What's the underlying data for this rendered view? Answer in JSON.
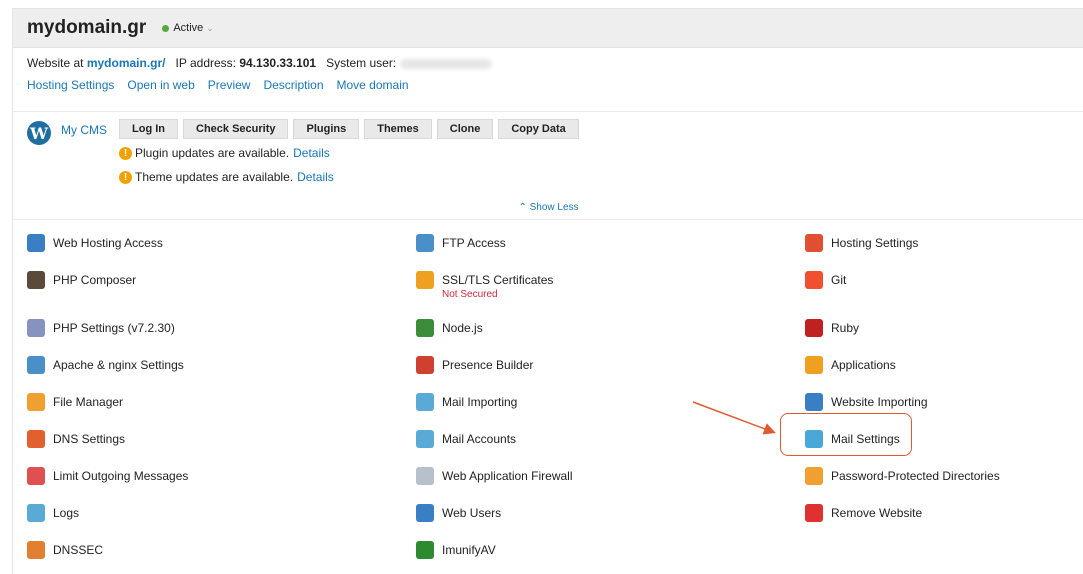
{
  "header": {
    "domain": "mydomain.gr",
    "status": "Active"
  },
  "info": {
    "website_prefix": "Website at",
    "website_link": "mydomain.gr/",
    "ip_label": "IP address:",
    "ip_value": "94.130.33.101",
    "user_label": "System user:",
    "links": [
      "Hosting Settings",
      "Open in web",
      "Preview",
      "Description",
      "Move domain"
    ]
  },
  "cms": {
    "label": "My CMS",
    "buttons": [
      "Log In",
      "Check Security",
      "Plugins",
      "Themes",
      "Clone",
      "Copy Data"
    ],
    "alerts": [
      {
        "text": "Plugin updates are available.",
        "link": "Details"
      },
      {
        "text": "Theme updates are available.",
        "link": "Details"
      }
    ]
  },
  "show_less": "Show Less",
  "tools": {
    "col1": [
      {
        "label": "Web Hosting Access",
        "icon": "globe-icon",
        "color": "#3a7fc4"
      },
      {
        "label": "PHP Composer",
        "icon": "composer-icon",
        "color": "#5a4a3a"
      },
      {
        "label": "PHP Settings (v7.2.30)",
        "icon": "php-icon",
        "color": "#8892bf"
      },
      {
        "label": "Apache & nginx Settings",
        "icon": "server-settings-icon",
        "color": "#4a90c8"
      },
      {
        "label": "File Manager",
        "icon": "folder-icon",
        "color": "#f0a030"
      },
      {
        "label": "DNS Settings",
        "icon": "dns-flags-icon",
        "color": "#e06030"
      },
      {
        "label": "Limit Outgoing Messages",
        "icon": "mail-limit-icon",
        "color": "#e05050"
      },
      {
        "label": "Logs",
        "icon": "logs-icon",
        "color": "#5aaad8"
      },
      {
        "label": "DNSSEC",
        "icon": "dnssec-icon",
        "color": "#e08030"
      }
    ],
    "col2": [
      {
        "label": "FTP Access",
        "icon": "ftp-icon",
        "color": "#4a90c8"
      },
      {
        "label": "SSL/TLS Certificates",
        "sub": "Not Secured",
        "icon": "lock-icon",
        "color": "#f0a020"
      },
      {
        "label": "Node.js",
        "icon": "nodejs-icon",
        "color": "#3c8c3c"
      },
      {
        "label": "Presence Builder",
        "icon": "tools-icon",
        "color": "#d04030"
      },
      {
        "label": "Mail Importing",
        "icon": "mail-import-icon",
        "color": "#5aaad8"
      },
      {
        "label": "Mail Accounts",
        "icon": "mail-icon",
        "color": "#5aaad8"
      },
      {
        "label": "Web Application Firewall",
        "icon": "shield-icon",
        "color": "#b8c0cc"
      },
      {
        "label": "Web Users",
        "icon": "web-users-icon",
        "color": "#3a7fc4"
      },
      {
        "label": "ImunifyAV",
        "icon": "gear-icon",
        "color": "#2e8a2e"
      }
    ],
    "col3": [
      {
        "label": "Hosting Settings",
        "icon": "hosting-settings-icon",
        "color": "#e05030"
      },
      {
        "label": "Git",
        "icon": "git-icon",
        "color": "#f05030"
      },
      {
        "label": "Ruby",
        "icon": "ruby-icon",
        "color": "#c02020"
      },
      {
        "label": "Applications",
        "icon": "sun-gear-icon",
        "color": "#f0a020"
      },
      {
        "label": "Website Importing",
        "icon": "website-import-icon",
        "color": "#3a7fc4"
      },
      {
        "label": "Mail Settings",
        "icon": "mail-settings-icon",
        "color": "#4aa8d8"
      },
      {
        "label": "Password-Protected Directories",
        "icon": "protected-folder-icon",
        "color": "#f0a030"
      },
      {
        "label": "Remove Website",
        "icon": "remove-icon",
        "color": "#e03030"
      }
    ]
  }
}
